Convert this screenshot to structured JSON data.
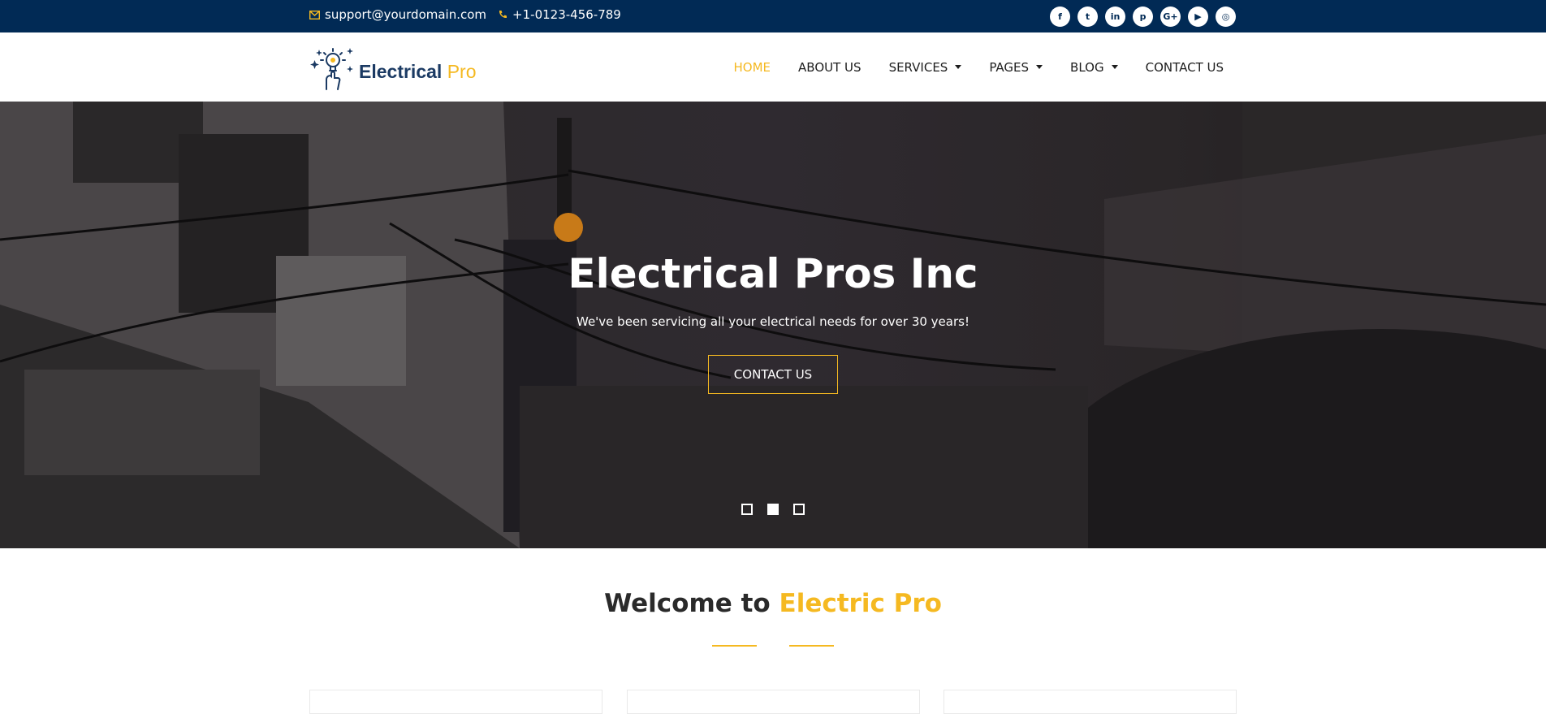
{
  "topbar": {
    "email": "support@yourdomain.com",
    "phone": "+1-0123-456-789",
    "email_icon": "envelope-icon",
    "phone_icon": "phone-icon",
    "social": [
      {
        "icon": "facebook-icon",
        "glyph": "f"
      },
      {
        "icon": "twitter-icon",
        "glyph": "t"
      },
      {
        "icon": "linkedin-icon",
        "glyph": "in"
      },
      {
        "icon": "pinterest-icon",
        "glyph": "p"
      },
      {
        "icon": "google-plus-icon",
        "glyph": "G+"
      },
      {
        "icon": "youtube-icon",
        "glyph": "▶"
      },
      {
        "icon": "dribbble-icon",
        "glyph": "◎"
      }
    ]
  },
  "logo": {
    "brand_main": "Electrical",
    "brand_accent": "Pro"
  },
  "nav": {
    "items": [
      {
        "label": "HOME",
        "active": true,
        "dropdown": false
      },
      {
        "label": "ABOUT US",
        "active": false,
        "dropdown": false
      },
      {
        "label": "SERVICES",
        "active": false,
        "dropdown": true
      },
      {
        "label": "PAGES",
        "active": false,
        "dropdown": true
      },
      {
        "label": "BLOG",
        "active": false,
        "dropdown": true
      },
      {
        "label": "CONTACT US",
        "active": false,
        "dropdown": false
      }
    ]
  },
  "hero": {
    "title": "Electrical Pros Inc",
    "subtitle": "We've been servicing all your electrical needs for over 30 years!",
    "cta_label": "CONTACT US",
    "slides": 3,
    "active_slide": 2
  },
  "welcome": {
    "prefix": "Welcome to",
    "accent": "Electric Pro"
  },
  "colors": {
    "accent": "#f5b921",
    "topbar": "#012a55",
    "text": "#1d1d1d"
  }
}
